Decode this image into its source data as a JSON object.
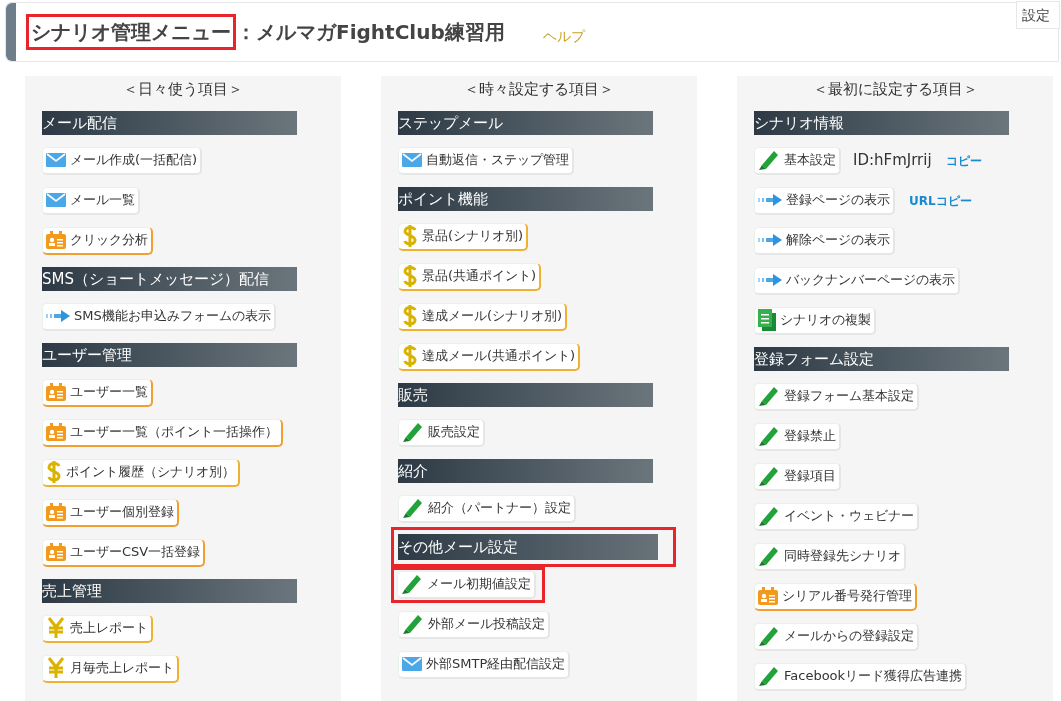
{
  "header": {
    "title_main": "シナリオ管理メニュー",
    "title_main_highlighted": true,
    "title_rest": "：メルマガFightClub練習用",
    "help_link": "ヘルプ",
    "corner_button": "設定"
  },
  "columns": [
    {
      "heading": "＜日々使う項目＞",
      "sections": [
        {
          "title": "メール配信",
          "highlighted": false,
          "items": [
            {
              "kind": "mail",
              "label": "メール作成(一括配信)",
              "highlighted": false
            },
            {
              "kind": "mail",
              "label": "メール一覧",
              "highlighted": false
            },
            {
              "kind": "card",
              "label": "クリック分析",
              "highlighted": false
            }
          ]
        },
        {
          "title": "SMS（ショートメッセージ）配信",
          "highlighted": false,
          "items": [
            {
              "kind": "arrow",
              "label": "SMS機能お申込みフォームの表示",
              "highlighted": false
            }
          ]
        },
        {
          "title": "ユーザー管理",
          "highlighted": false,
          "items": [
            {
              "kind": "card",
              "label": "ユーザー一覧",
              "highlighted": false
            },
            {
              "kind": "card",
              "label": "ユーザー一覧（ポイント一括操作）",
              "highlighted": false
            },
            {
              "kind": "dollar",
              "label": "ポイント履歴（シナリオ別）",
              "highlighted": false
            },
            {
              "kind": "card",
              "label": "ユーザー個別登録",
              "highlighted": false
            },
            {
              "kind": "card",
              "label": "ユーザーCSV一括登録",
              "highlighted": false
            }
          ]
        },
        {
          "title": "売上管理",
          "highlighted": false,
          "items": [
            {
              "kind": "yen",
              "label": "売上レポート",
              "highlighted": false
            },
            {
              "kind": "yen",
              "label": "月毎売上レポート",
              "highlighted": false
            }
          ]
        }
      ]
    },
    {
      "heading": "＜時々設定する項目＞",
      "sections": [
        {
          "title": "ステップメール",
          "highlighted": false,
          "items": [
            {
              "kind": "mail",
              "label": "自動返信・ステップ管理",
              "highlighted": false
            }
          ]
        },
        {
          "title": "ポイント機能",
          "highlighted": false,
          "items": [
            {
              "kind": "dollar",
              "label": "景品(シナリオ別)",
              "highlighted": false
            },
            {
              "kind": "dollar",
              "label": "景品(共通ポイント)",
              "highlighted": false
            },
            {
              "kind": "dollar",
              "label": "達成メール(シナリオ別)",
              "highlighted": false
            },
            {
              "kind": "dollar",
              "label": "達成メール(共通ポイント)",
              "highlighted": false
            }
          ]
        },
        {
          "title": "販売",
          "highlighted": false,
          "items": [
            {
              "kind": "pencil",
              "label": "販売設定",
              "highlighted": false
            }
          ]
        },
        {
          "title": "紹介",
          "highlighted": false,
          "items": [
            {
              "kind": "pencil",
              "label": "紹介（パートナー）設定",
              "highlighted": false
            }
          ]
        },
        {
          "title": "その他メール設定",
          "highlighted": true,
          "items": [
            {
              "kind": "pencil",
              "label": "メール初期値設定",
              "highlighted": true
            },
            {
              "kind": "pencil",
              "label": "外部メール投稿設定",
              "highlighted": false
            },
            {
              "kind": "mail",
              "label": "外部SMTP経由配信設定",
              "highlighted": false
            }
          ]
        }
      ]
    },
    {
      "heading": "＜最初に設定する項目＞",
      "sections": [
        {
          "title": "シナリオ情報",
          "highlighted": false,
          "items": [
            {
              "kind": "pencil",
              "label": "基本設定",
              "highlighted": false,
              "note": "ID:hFmJrrij",
              "link": "コピー"
            },
            {
              "kind": "arrow",
              "label": "登録ページの表示",
              "highlighted": false,
              "link": "URLコピー"
            },
            {
              "kind": "arrow",
              "label": "解除ページの表示",
              "highlighted": false
            },
            {
              "kind": "arrow",
              "label": "バックナンバーページの表示",
              "highlighted": false
            },
            {
              "kind": "copy",
              "label": "シナリオの複製",
              "highlighted": false
            }
          ]
        },
        {
          "title": "登録フォーム設定",
          "highlighted": false,
          "items": [
            {
              "kind": "pencil",
              "label": "登録フォーム基本設定",
              "highlighted": false
            },
            {
              "kind": "pencil",
              "label": "登録禁止",
              "highlighted": false
            },
            {
              "kind": "pencil",
              "label": "登録項目",
              "highlighted": false
            },
            {
              "kind": "pencil",
              "label": "イベント・ウェビナー",
              "highlighted": false
            },
            {
              "kind": "pencil",
              "label": "同時登録先シナリオ",
              "highlighted": false
            },
            {
              "kind": "card",
              "label": "シリアル番号発行管理",
              "highlighted": false
            },
            {
              "kind": "pencil",
              "label": "メールからの登録設定",
              "highlighted": false
            },
            {
              "kind": "pencil",
              "label": "Facebookリード獲得広告連携",
              "highlighted": false
            }
          ]
        }
      ]
    }
  ]
}
